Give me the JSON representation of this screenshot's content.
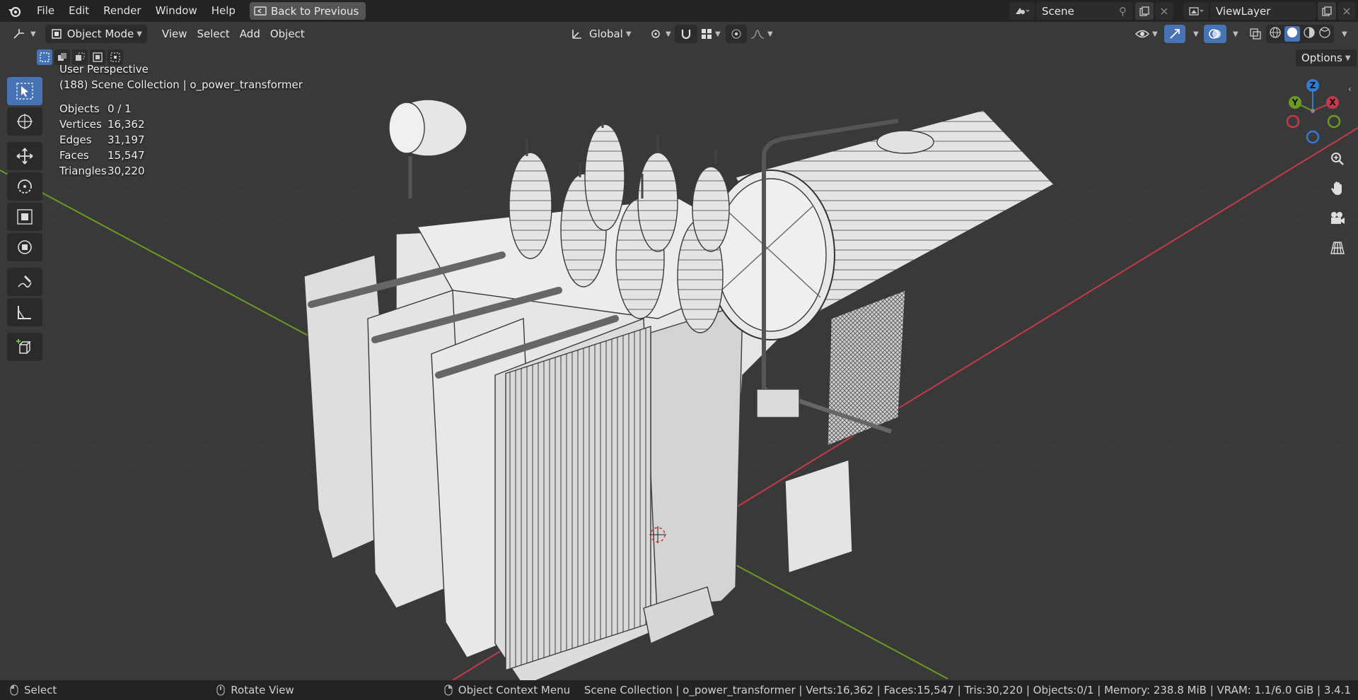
{
  "menu": {
    "file": "File",
    "edit": "Edit",
    "render": "Render",
    "window": "Window",
    "help": "Help",
    "back": "Back to Previous"
  },
  "scene": {
    "name": "Scene",
    "view_layer": "ViewLayer"
  },
  "header": {
    "mode": "Object Mode",
    "view": "View",
    "select": "Select",
    "add": "Add",
    "object": "Object",
    "orientation": "Global",
    "options": "Options"
  },
  "viewport_info": {
    "perspective": "User Perspective",
    "collection": "(188) Scene Collection | o_power_transformer",
    "stats": [
      {
        "label": "Objects",
        "value": "0 / 1"
      },
      {
        "label": "Vertices",
        "value": "16,362"
      },
      {
        "label": "Edges",
        "value": "31,197"
      },
      {
        "label": "Faces",
        "value": "15,547"
      },
      {
        "label": "Triangles",
        "value": "30,220"
      }
    ]
  },
  "gizmo": {
    "x": "X",
    "y": "Y",
    "z": "Z"
  },
  "status": {
    "select": "Select",
    "rotate": "Rotate View",
    "context": "Object Context Menu",
    "info": "Scene Collection | o_power_transformer | Verts:16,362 | Faces:15,547 | Tris:30,220 | Objects:0/1 | Memory: 238.8 MiB | VRAM: 1.1/6.0 GiB | 3.4.1"
  },
  "colors": {
    "accent": "#4772b3",
    "x_axis": "#c33a4b",
    "y_axis": "#6a9a23",
    "z_axis": "#2f7bd8"
  }
}
